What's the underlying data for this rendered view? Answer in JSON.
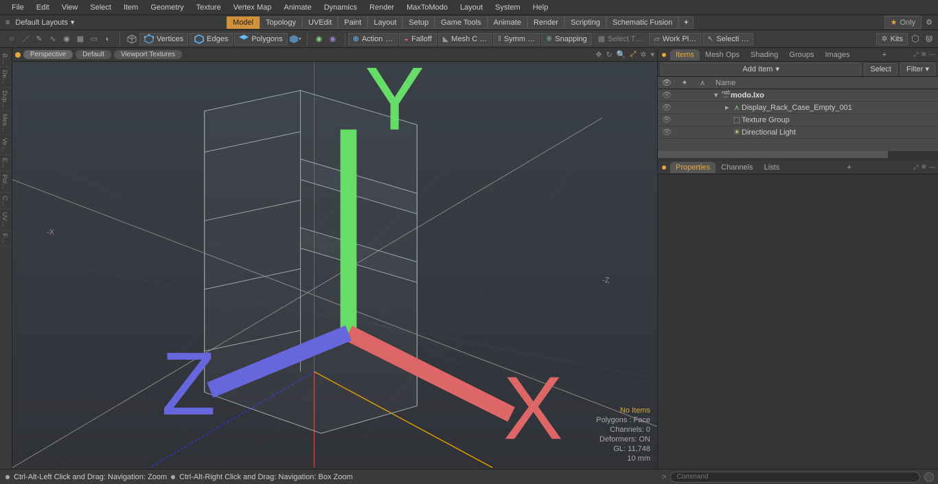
{
  "menubar": [
    "File",
    "Edit",
    "View",
    "Select",
    "Item",
    "Geometry",
    "Texture",
    "Vertex Map",
    "Animate",
    "Dynamics",
    "Render",
    "MaxToModo",
    "Layout",
    "System",
    "Help"
  ],
  "layout": {
    "dropdown": "Default Layouts",
    "tabs": [
      "Model",
      "Topology",
      "UVEdit",
      "Paint",
      "Layout",
      "Setup",
      "Game Tools",
      "Animate",
      "Render",
      "Scripting",
      "Schematic Fusion"
    ],
    "active_tab": 0,
    "only": "Only"
  },
  "toolrow": {
    "vertices": "Vertices",
    "edges": "Edges",
    "polygons": "Polygons",
    "action": "Action",
    "falloff": "Falloff",
    "meshc": "Mesh C …",
    "symm": "Symm …",
    "snapping": "Snapping",
    "selectt": "Select T…",
    "workpl": "Work Pl…",
    "selecti": "Selecti …",
    "kits": "Kits"
  },
  "left_vtabs": [
    "B…",
    "De…",
    "Dup…",
    "Mes…",
    "Ve…",
    "E…",
    "Pol…",
    "C…",
    "UV…",
    "F…"
  ],
  "viewport": {
    "tabs": [
      "Perspective",
      "Default",
      "Viewport Textures"
    ],
    "status": {
      "no_items": "No Items",
      "polygons": "Polygons : Face",
      "channels": "Channels: 0",
      "deformers": "Deformers: ON",
      "gl": "GL: 11,748",
      "units": "10 mm"
    }
  },
  "items_panel": {
    "tabs": [
      "Items",
      "Mesh Ops",
      "Shading",
      "Groups",
      "Images"
    ],
    "active_tab": 0,
    "add_item": "Add Item",
    "select_btn": "Select",
    "filter_btn": "Filter",
    "name_col": "Name",
    "tree": [
      {
        "depth": 0,
        "expander": "▾",
        "icon": "🎬",
        "name": "modo.lxo",
        "bold": true
      },
      {
        "depth": 1,
        "expander": "▸",
        "icon": "⋏",
        "icon_color": "#8c8",
        "name": "Display_Rack_Case_Empty_001"
      },
      {
        "depth": 1,
        "expander": "",
        "icon": "⬚",
        "name": "Texture Group"
      },
      {
        "depth": 1,
        "expander": "",
        "icon": "☀",
        "name": "Directional Light"
      }
    ]
  },
  "properties_panel": {
    "tabs": [
      "Properties",
      "Channels",
      "Lists"
    ],
    "active_tab": 0
  },
  "status_bar": {
    "left1": "Ctrl-Alt-Left Click and Drag: Navigation: Zoom",
    "left2": "Ctrl-Alt-Right Click and Drag: Navigation: Box Zoom",
    "command_placeholder": "Command"
  }
}
